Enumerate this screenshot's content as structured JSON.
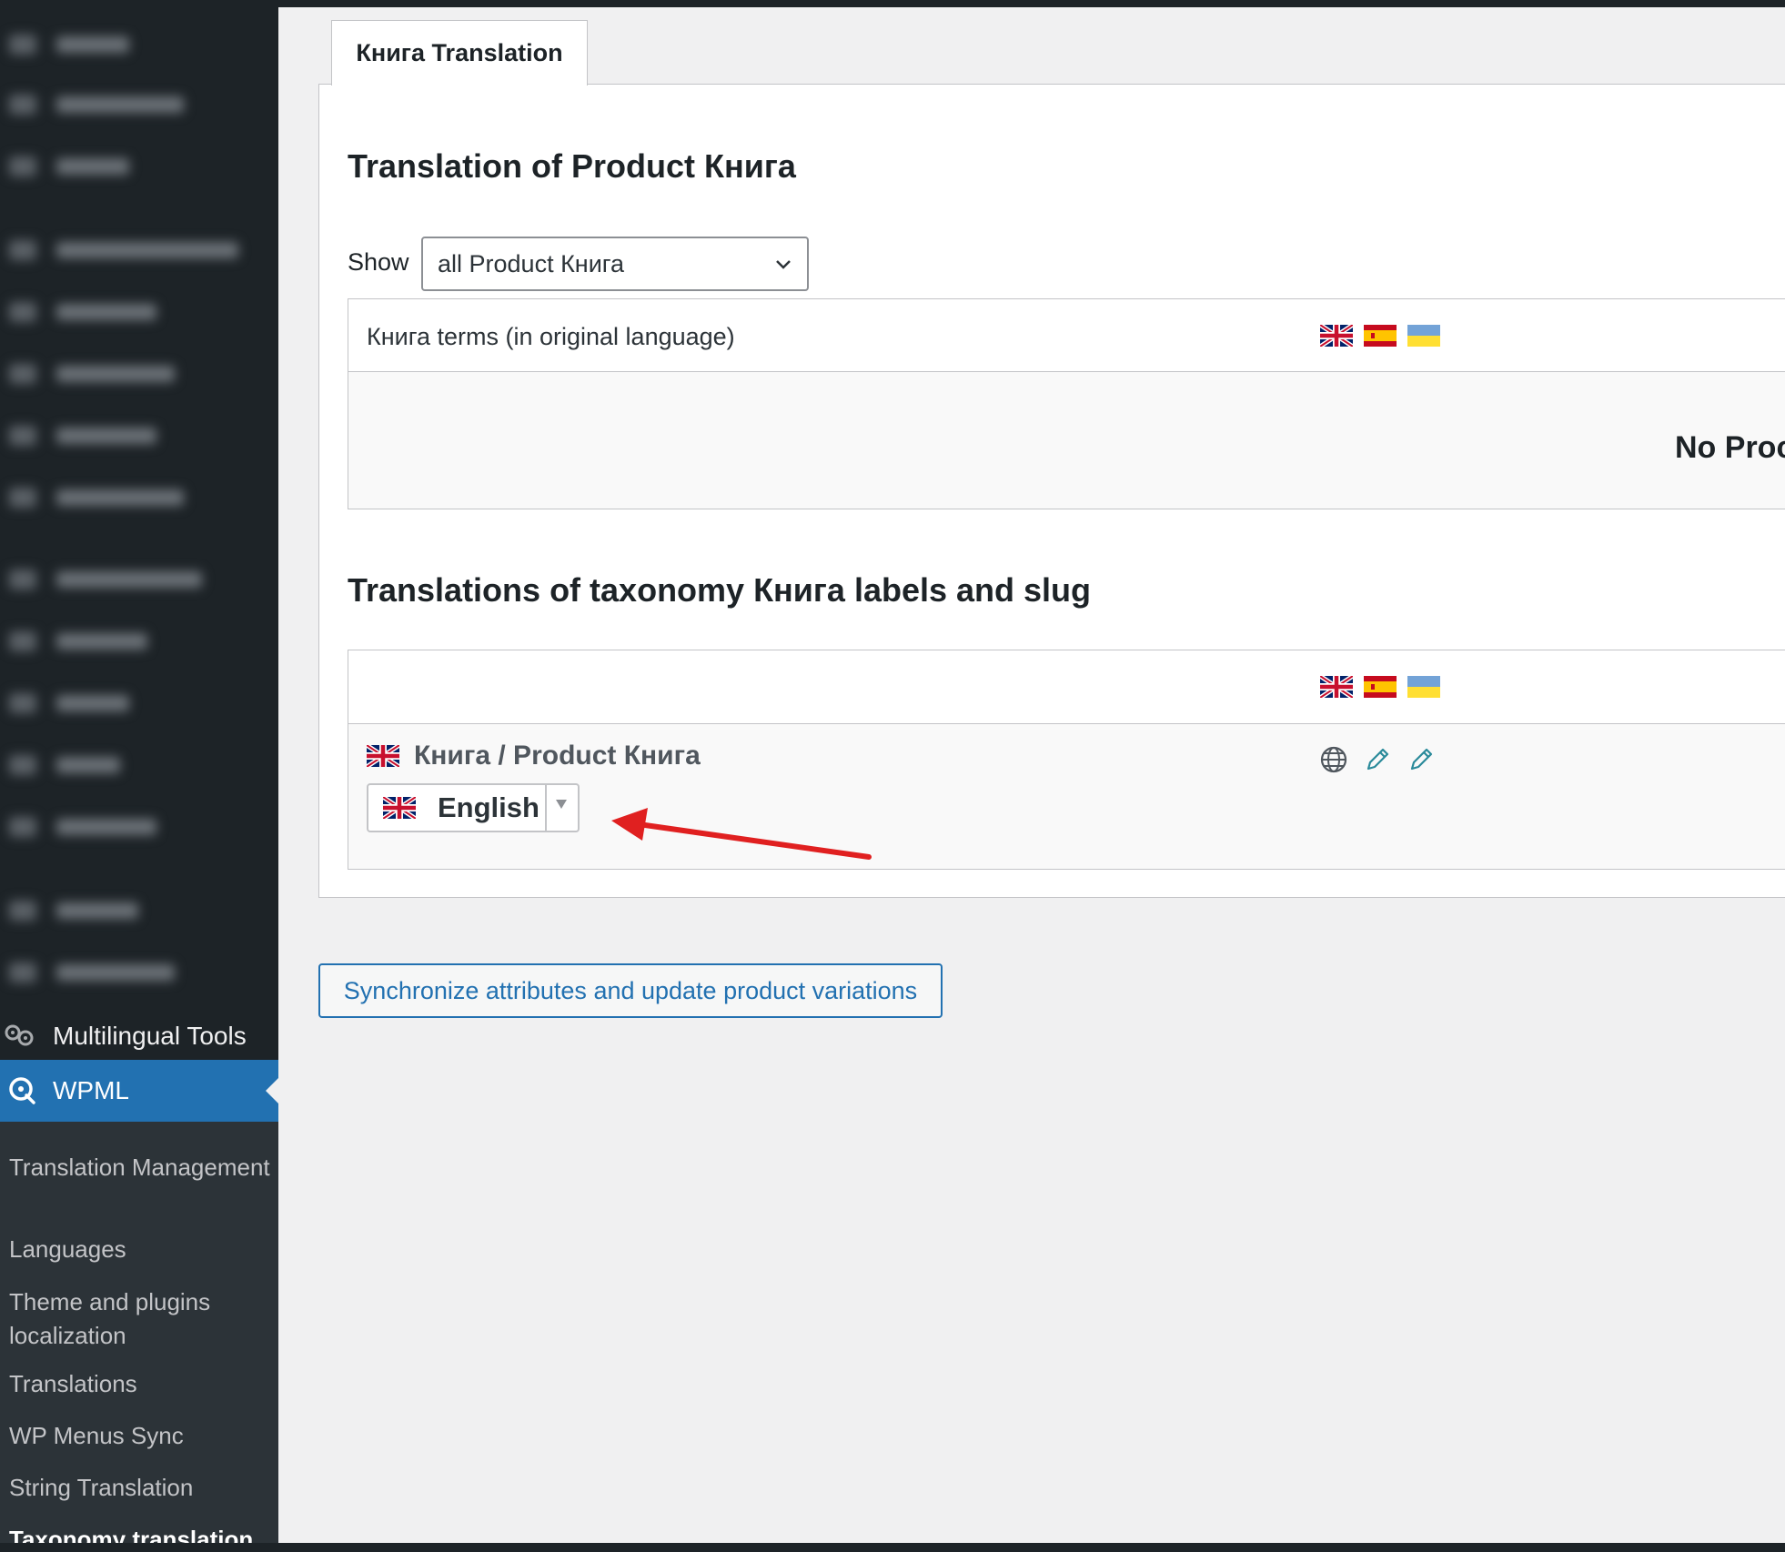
{
  "tab": {
    "label": "Книга Translation"
  },
  "section1": {
    "title": "Translation of Product Книга",
    "show_label": "Show",
    "show_select": {
      "value": "all Product Книга"
    },
    "table_header": "Книга terms (in original language)",
    "empty_message": "No Proc"
  },
  "section2": {
    "title": "Translations of taxonomy Книга labels and slug",
    "row": {
      "name": "Книга / Product Книга",
      "language_select": {
        "value": "English"
      }
    }
  },
  "flags": [
    "uk-flag",
    "spain-flag",
    "ukraine-flag"
  ],
  "row_actions": [
    "globe-icon",
    "pencil-icon",
    "pencil-icon"
  ],
  "sync_button": {
    "label": "Synchronize attributes and update product variations"
  },
  "sidebar": {
    "multilingual": {
      "label": "Multilingual Tools"
    },
    "wpml": {
      "label": "WPML"
    },
    "submenu": [
      {
        "label": "Translation Management"
      },
      {
        "label": "Languages"
      },
      {
        "label": "Theme and plugins localization"
      },
      {
        "label": "Translations"
      },
      {
        "label": "WP Menus Sync"
      },
      {
        "label": "String Translation"
      },
      {
        "label": "Taxonomy translation"
      }
    ]
  },
  "colors": {
    "admin_sidebar": "#1d2327",
    "submenu_bg": "#2c3338",
    "accent": "#2271b1",
    "annotation_arrow": "#e02020"
  }
}
